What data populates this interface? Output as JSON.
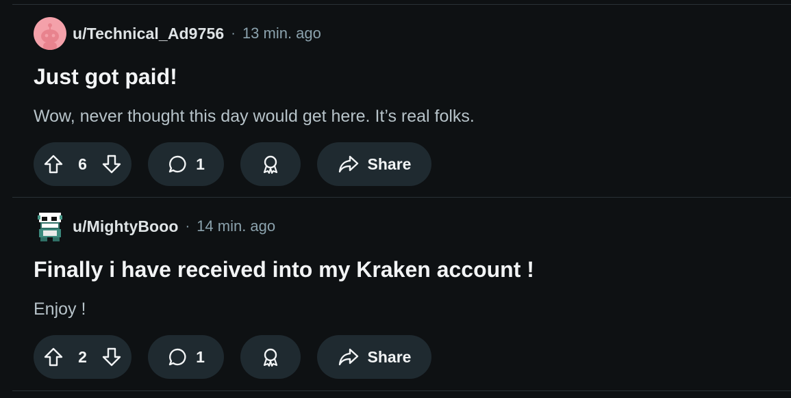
{
  "posts": [
    {
      "username": "u/Technical_Ad9756",
      "separator": "·",
      "time": "13 min. ago",
      "title": "Just got paid!",
      "body": "Wow, never thought this day would get here. It’s real folks.",
      "score": "6",
      "comments": "1",
      "share_label": "Share",
      "avatar_icon": "snoo-avatar-icon"
    },
    {
      "username": "u/MightyBooo",
      "separator": "·",
      "time": "14 min. ago",
      "title": "Finally i have received into my Kraken account !",
      "body": "Enjoy !",
      "score": "2",
      "comments": "1",
      "share_label": "Share",
      "avatar_icon": "pixel-avatar-icon"
    }
  ],
  "colors": {
    "background": "#0e1113",
    "pill": "#1f2a30",
    "divider": "#2a3236",
    "muted_text": "#8ba2ad",
    "body_text": "#b7c3c9",
    "avatar_pink": "#f4a1aa"
  }
}
